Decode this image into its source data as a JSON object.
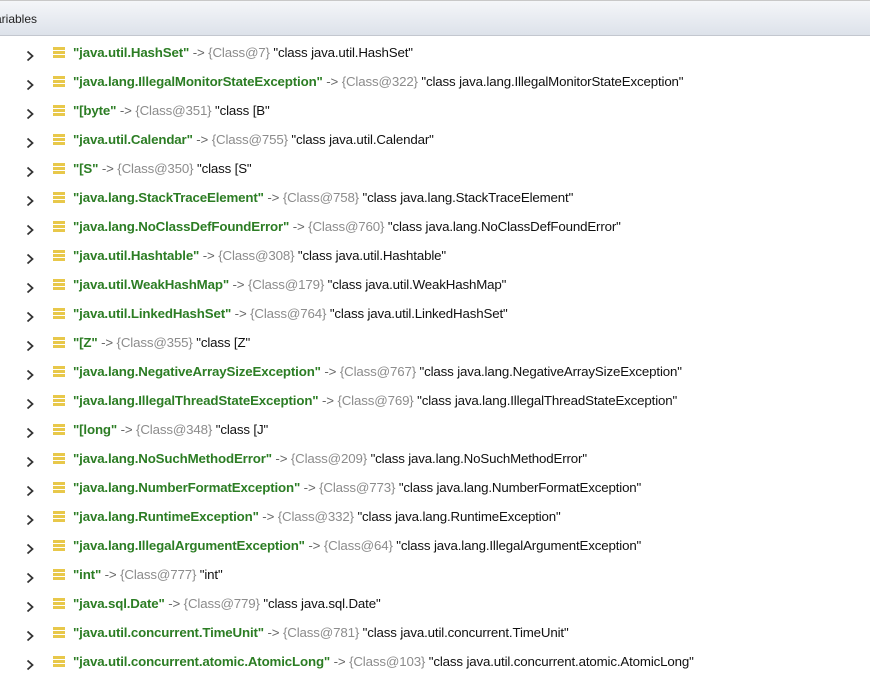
{
  "panel": {
    "title": "ariables"
  },
  "theme": {
    "key_color": "#2c7d24",
    "ref_color": "#8c8c8c",
    "icon_color": "#e8c84a",
    "chevron_color": "#333333"
  },
  "entries": [
    {
      "key": "\"java.util.HashSet\"",
      "arrow": " -> ",
      "ref": "{Class@7}",
      "value": " \"class java.util.HashSet\""
    },
    {
      "key": "\"java.lang.IllegalMonitorStateException\"",
      "arrow": " -> ",
      "ref": "{Class@322}",
      "value": " \"class java.lang.IllegalMonitorStateException\""
    },
    {
      "key": "\"[byte\"",
      "arrow": " -> ",
      "ref": "{Class@351}",
      "value": " \"class [B\""
    },
    {
      "key": "\"java.util.Calendar\"",
      "arrow": " -> ",
      "ref": "{Class@755}",
      "value": " \"class java.util.Calendar\""
    },
    {
      "key": "\"[S\"",
      "arrow": " -> ",
      "ref": "{Class@350}",
      "value": " \"class [S\""
    },
    {
      "key": "\"java.lang.StackTraceElement\"",
      "arrow": " -> ",
      "ref": "{Class@758}",
      "value": " \"class java.lang.StackTraceElement\""
    },
    {
      "key": "\"java.lang.NoClassDefFoundError\"",
      "arrow": " -> ",
      "ref": "{Class@760}",
      "value": " \"class java.lang.NoClassDefFoundError\""
    },
    {
      "key": "\"java.util.Hashtable\"",
      "arrow": " -> ",
      "ref": "{Class@308}",
      "value": " \"class java.util.Hashtable\""
    },
    {
      "key": "\"java.util.WeakHashMap\"",
      "arrow": " -> ",
      "ref": "{Class@179}",
      "value": " \"class java.util.WeakHashMap\""
    },
    {
      "key": "\"java.util.LinkedHashSet\"",
      "arrow": " -> ",
      "ref": "{Class@764}",
      "value": " \"class java.util.LinkedHashSet\""
    },
    {
      "key": "\"[Z\"",
      "arrow": " -> ",
      "ref": "{Class@355}",
      "value": " \"class [Z\""
    },
    {
      "key": "\"java.lang.NegativeArraySizeException\"",
      "arrow": " -> ",
      "ref": "{Class@767}",
      "value": " \"class java.lang.NegativeArraySizeException\""
    },
    {
      "key": "\"java.lang.IllegalThreadStateException\"",
      "arrow": " -> ",
      "ref": "{Class@769}",
      "value": " \"class java.lang.IllegalThreadStateException\""
    },
    {
      "key": "\"[long\"",
      "arrow": " -> ",
      "ref": "{Class@348}",
      "value": " \"class [J\""
    },
    {
      "key": "\"java.lang.NoSuchMethodError\"",
      "arrow": " -> ",
      "ref": "{Class@209}",
      "value": " \"class java.lang.NoSuchMethodError\""
    },
    {
      "key": "\"java.lang.NumberFormatException\"",
      "arrow": " -> ",
      "ref": "{Class@773}",
      "value": " \"class java.lang.NumberFormatException\""
    },
    {
      "key": "\"java.lang.RuntimeException\"",
      "arrow": " -> ",
      "ref": "{Class@332}",
      "value": " \"class java.lang.RuntimeException\""
    },
    {
      "key": "\"java.lang.IllegalArgumentException\"",
      "arrow": " -> ",
      "ref": "{Class@64}",
      "value": " \"class java.lang.IllegalArgumentException\""
    },
    {
      "key": "\"int\"",
      "arrow": " -> ",
      "ref": "{Class@777}",
      "value": " \"int\""
    },
    {
      "key": "\"java.sql.Date\"",
      "arrow": " -> ",
      "ref": "{Class@779}",
      "value": " \"class java.sql.Date\""
    },
    {
      "key": "\"java.util.concurrent.TimeUnit\"",
      "arrow": " -> ",
      "ref": "{Class@781}",
      "value": " \"class java.util.concurrent.TimeUnit\""
    },
    {
      "key": "\"java.util.concurrent.atomic.AtomicLong\"",
      "arrow": " -> ",
      "ref": "{Class@103}",
      "value": " \"class java.util.concurrent.atomic.AtomicLong\""
    }
  ]
}
